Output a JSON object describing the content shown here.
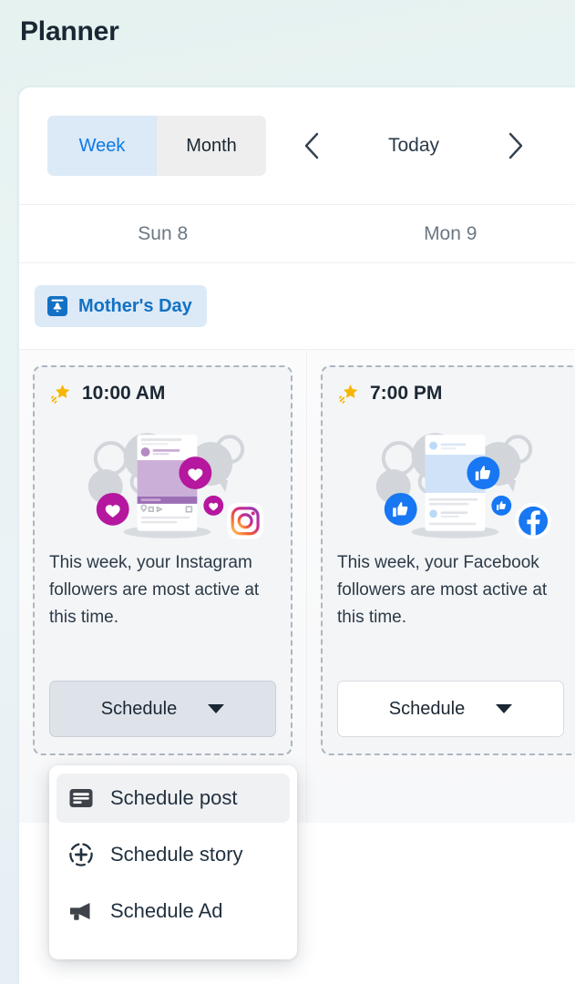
{
  "header": {
    "title": "Planner"
  },
  "toolbar": {
    "week_label": "Week",
    "month_label": "Month",
    "today_label": "Today",
    "prev_icon": "chevron-left-icon",
    "next_icon": "chevron-right-icon"
  },
  "calendar": {
    "days": [
      {
        "label": "Sun 8"
      },
      {
        "label": "Mon 9"
      }
    ],
    "events": [
      {
        "label": "Mother's Day",
        "icon": "bell-badge-icon",
        "color": "#1271c4",
        "background": "#dce9f7"
      }
    ]
  },
  "suggestions": [
    {
      "time": "10:00 AM",
      "network": "Instagram",
      "icon": "sparkle-icon",
      "illustration": "instagram-engagement-illustration",
      "text": "This week, your Instagram followers are most active at this time.",
      "button_label": "Schedule",
      "button_state": "pressed"
    },
    {
      "time": "7:00 PM",
      "network": "Facebook",
      "icon": "sparkle-icon",
      "illustration": "facebook-engagement-illustration",
      "text": "This week, your Facebook followers are most active at this time.",
      "button_label": "Schedule",
      "button_state": "default"
    }
  ],
  "schedule_menu": {
    "items": [
      {
        "label": "Schedule post",
        "icon": "post-card-icon",
        "active": true
      },
      {
        "label": "Schedule story",
        "icon": "story-plus-circle-icon",
        "active": false
      },
      {
        "label": "Schedule Ad",
        "icon": "megaphone-icon",
        "active": false
      }
    ]
  },
  "colors": {
    "accent_blue": "#0b7be5",
    "event_blue": "#1271c4",
    "text_dark": "#1b2733",
    "text_muted": "#6b7884",
    "instagram_magenta": "#b5179e",
    "facebook_blue": "#1877f2",
    "sparkle_gold": "#f7b500"
  }
}
